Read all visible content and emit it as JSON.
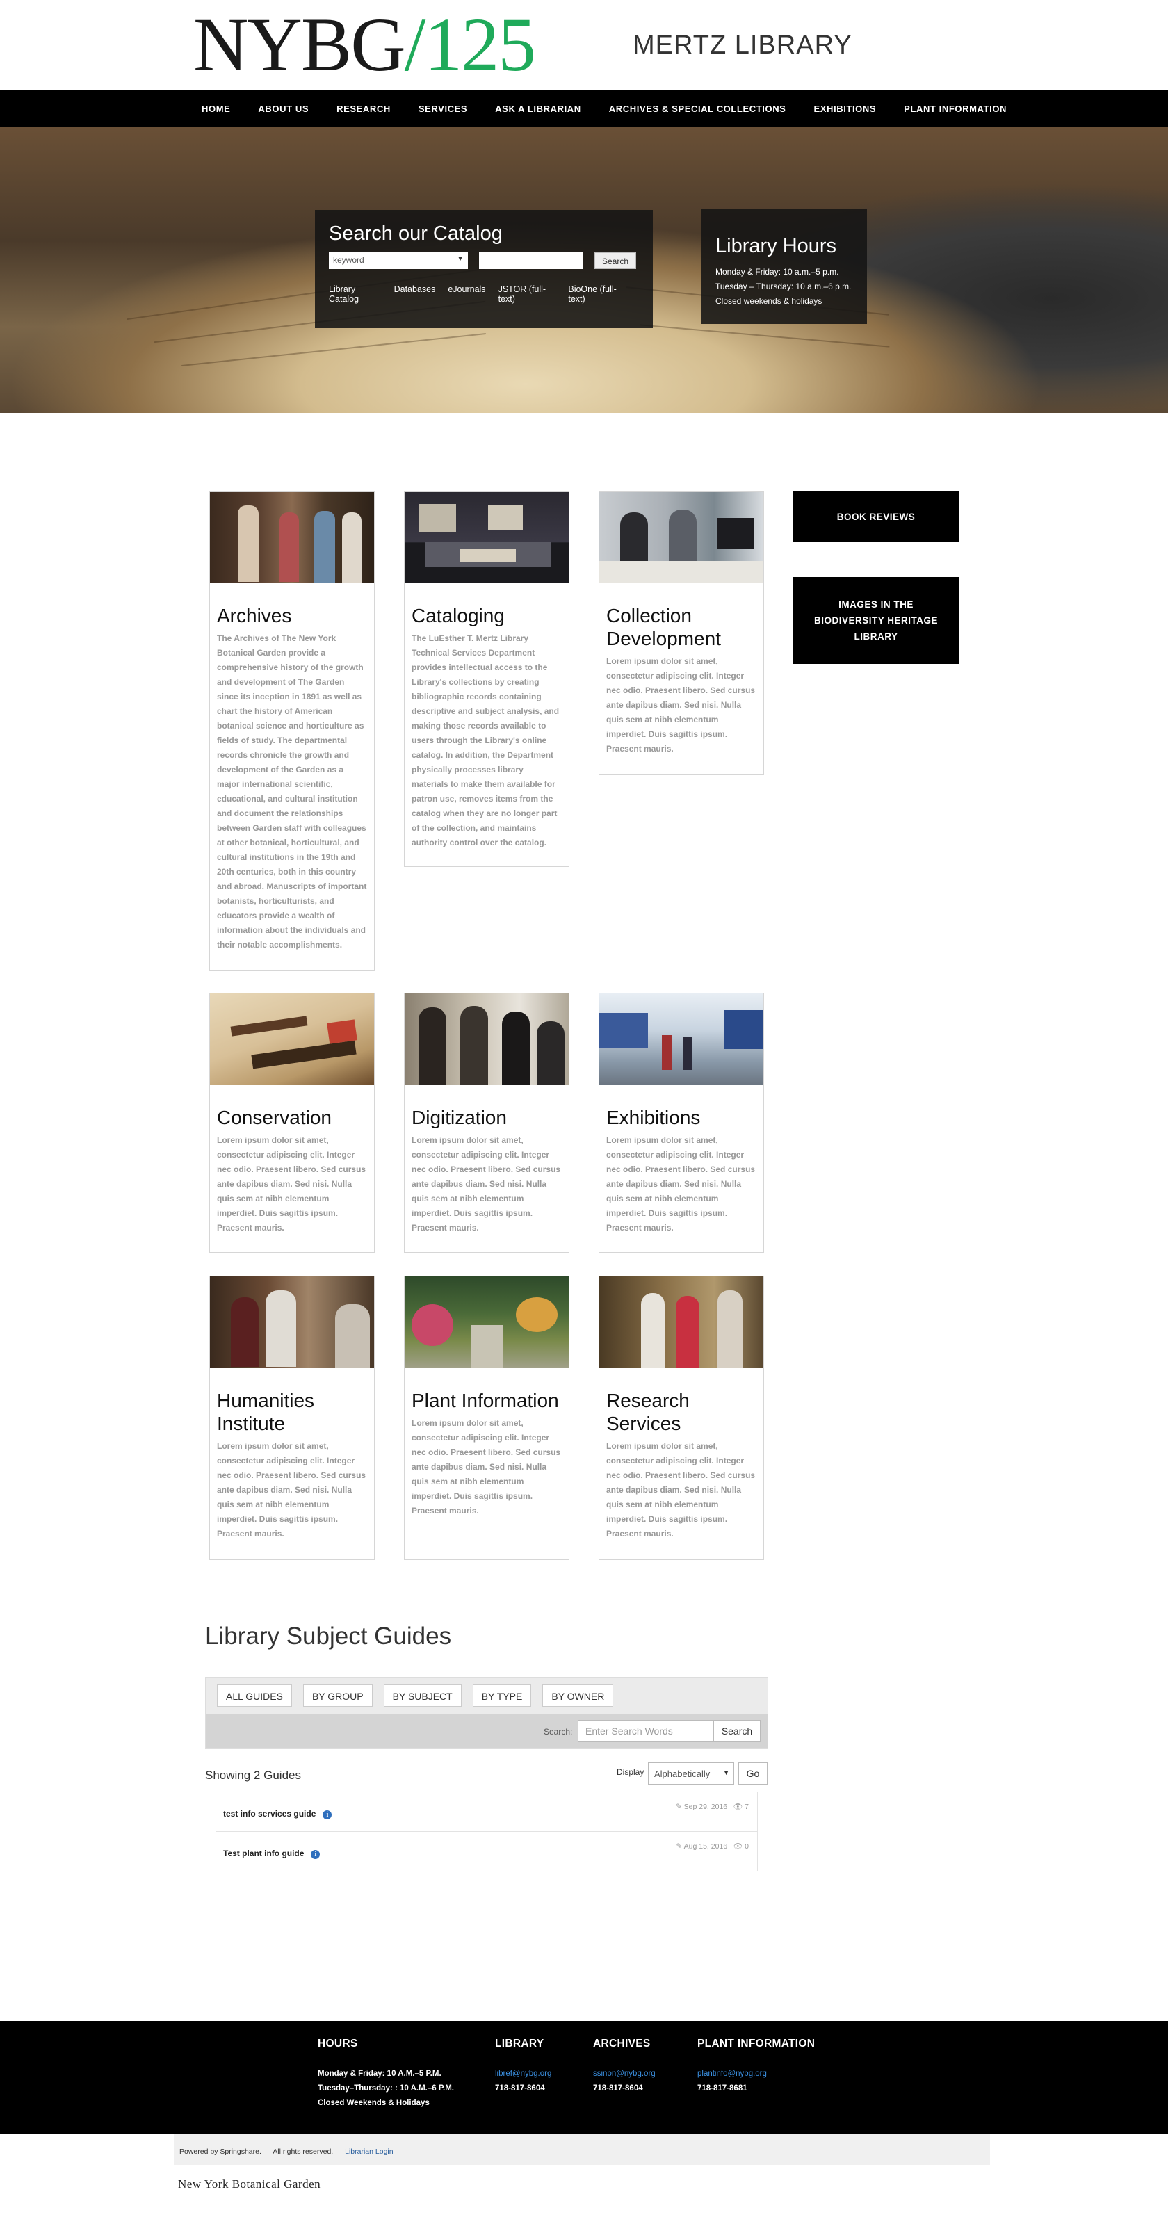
{
  "header": {
    "logo_main": "NYBG",
    "logo_accent": "/125",
    "title": "MERTZ LIBRARY"
  },
  "nav": {
    "items": [
      {
        "label": "HOME"
      },
      {
        "label": "ABOUT US"
      },
      {
        "label": "RESEARCH"
      },
      {
        "label": "SERVICES"
      },
      {
        "label": "ASK A LIBRARIAN"
      },
      {
        "label": "ARCHIVES & SPECIAL COLLECTIONS"
      },
      {
        "label": "EXHIBITIONS"
      },
      {
        "label": "PLANT INFORMATION"
      }
    ]
  },
  "search_panel": {
    "title": "Search our Catalog",
    "select_value": "keyword",
    "button_label": "Search",
    "links": [
      {
        "label": "Library Catalog"
      },
      {
        "label": "Databases"
      },
      {
        "label": "eJournals"
      },
      {
        "label": "JSTOR (full-text)"
      },
      {
        "label": "BioOne (full-text)"
      }
    ]
  },
  "hours_panel": {
    "title": "Library Hours",
    "line1": "Monday & Friday: 10 a.m.–5 p.m.",
    "line2": "Tuesday – Thursday: 10 a.m.–6 p.m.",
    "line3": "Closed weekends & holidays"
  },
  "cards": [
    {
      "title": "Archives",
      "text": "The Archives of The New York Botanical Garden provide a comprehensive history of the growth and development of The Garden since its inception in 1891 as well as chart the history of American botanical science and horticulture as fields of study. The departmental records chronicle the growth and development of the Garden as a major international scientific, educational, and cultural institution and document the relationships between Garden staff with colleagues at other botanical, horticultural, and cultural institutions in the 19th and 20th centuries, both in this country and abroad. Manuscripts of important botanists, horticulturists, and educators provide a wealth of information about the individuals and their notable accomplishments."
    },
    {
      "title": "Cataloging",
      "text": "The LuEsther T. Mertz Library Technical Services Department provides intellectual access to the Library's collections by creating bibliographic records containing descriptive and subject analysis, and making those records available to users through the Library's online catalog. In addition, the Department physically processes library materials to make them available for patron use, removes items from the catalog when they are no longer part of the collection, and maintains authority control over the catalog."
    },
    {
      "title": "Collection Development",
      "text": "Lorem ipsum dolor sit amet, consectetur adipiscing elit. Integer nec odio. Praesent libero. Sed cursus ante dapibus diam. Sed nisi. Nulla quis sem at nibh elementum imperdiet. Duis sagittis ipsum. Praesent mauris."
    },
    {
      "title": "Conservation",
      "text": "Lorem ipsum dolor sit amet, consectetur adipiscing elit. Integer nec odio. Praesent libero. Sed cursus ante dapibus diam. Sed nisi. Nulla quis sem at nibh elementum imperdiet. Duis sagittis ipsum. Praesent mauris."
    },
    {
      "title": "Digitization",
      "text": "Lorem ipsum dolor sit amet, consectetur adipiscing elit. Integer nec odio. Praesent libero. Sed cursus ante dapibus diam. Sed nisi. Nulla quis sem at nibh elementum imperdiet. Duis sagittis ipsum. Praesent mauris."
    },
    {
      "title": "Exhibitions",
      "text": "Lorem ipsum dolor sit amet, consectetur adipiscing elit. Integer nec odio. Praesent libero. Sed cursus ante dapibus diam. Sed nisi. Nulla quis sem at nibh elementum imperdiet. Duis sagittis ipsum. Praesent mauris."
    },
    {
      "title": "Humanities Institute",
      "text": "Lorem ipsum dolor sit amet, consectetur adipiscing elit. Integer nec odio. Praesent libero. Sed cursus ante dapibus diam. Sed nisi. Nulla quis sem at nibh elementum imperdiet. Duis sagittis ipsum. Praesent mauris."
    },
    {
      "title": "Plant Information",
      "text": "Lorem ipsum dolor sit amet, consectetur adipiscing elit. Integer nec odio. Praesent libero. Sed cursus ante dapibus diam. Sed nisi. Nulla quis sem at nibh elementum imperdiet. Duis sagittis ipsum. Praesent mauris."
    },
    {
      "title": "Research Services",
      "text": "Lorem ipsum dolor sit amet, consectetur adipiscing elit. Integer nec odio. Praesent libero. Sed cursus ante dapibus diam. Sed nisi. Nulla quis sem at nibh elementum imperdiet. Duis sagittis ipsum. Praesent mauris."
    }
  ],
  "sidebar": {
    "book_reviews": "BOOK REVIEWS",
    "bhl": "IMAGES IN THE BIODIVERSITY HERITAGE LIBRARY"
  },
  "guides": {
    "title": "Library Subject Guides",
    "tabs": [
      {
        "label": "ALL GUIDES"
      },
      {
        "label": "BY GROUP"
      },
      {
        "label": "BY SUBJECT"
      },
      {
        "label": "BY TYPE"
      },
      {
        "label": "BY OWNER"
      }
    ],
    "search_label": "Search:",
    "search_placeholder": "Enter Search Words",
    "search_button": "Search",
    "showing": "Showing 2 Guides",
    "display_label": "Display",
    "display_value": "Alphabetically",
    "go_button": "Go",
    "items": [
      {
        "name": "test info services guide",
        "date": "Sep 29, 2016",
        "views": "7"
      },
      {
        "name": "Test plant info guide",
        "date": "Aug 15, 2016",
        "views": "0"
      }
    ]
  },
  "footer": {
    "hours": {
      "title": "HOURS",
      "line1": "Monday & Friday: 10 A.M.–5 P.M.",
      "line2": "Tuesday–Thursday: : 10 A.M.–6 P.M.",
      "line3": "Closed Weekends & Holidays"
    },
    "library": {
      "title": "LIBRARY",
      "email": "libref@nybg.org",
      "phone": "718-817-8604"
    },
    "archives": {
      "title": "ARCHIVES",
      "email": "ssinon@nybg.org",
      "phone": "718-817-8604"
    },
    "plant": {
      "title": "PLANT INFORMATION",
      "email": "plantinfo@nybg.org",
      "phone": "718-817-8681"
    }
  },
  "bottom": {
    "powered": "Powered by Springshare.",
    "rights": "All rights reserved.",
    "login": "Librarian Login",
    "nybg_name": "New York Botanical Garden"
  },
  "icons": {
    "info": "info-icon",
    "edit": "edit-icon",
    "eye": "eye-icon",
    "caret": "chevron-down-icon"
  },
  "colors": {
    "accent_green": "#1faa5a",
    "link_blue": "#3a8fe0",
    "info_blue": "#2f6fbd"
  }
}
